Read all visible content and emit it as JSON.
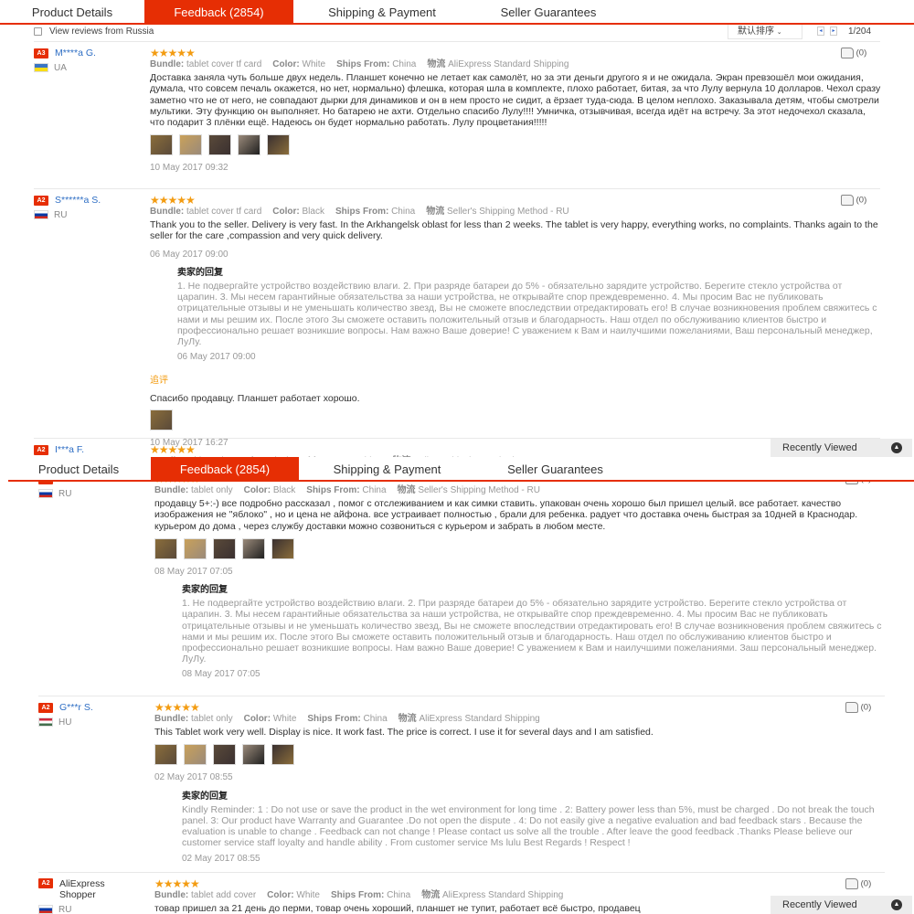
{
  "tabs": [
    "Product Details",
    "Feedback (2854)",
    "Shipping & Payment",
    "Seller Guarantees"
  ],
  "active_tab": 1,
  "accent": "#e62e04",
  "filter": {
    "checkbox_label": "View reviews from Russia",
    "sort_label": "默认排序",
    "sort_icon": "chevron-down-icon",
    "page": "1/204"
  },
  "recently_viewed": "Recently Viewed",
  "labels": {
    "bundle": "Bundle:",
    "color": "Color:",
    "ships_from": "Ships From:",
    "logistics": "物流",
    "seller_reply": "卖家的回复",
    "additional_feedback": "追评"
  },
  "reviews": [
    {
      "badge": "A3",
      "name": "M****a G.",
      "country": "UA",
      "flag_colors": [
        "#3a75c4",
        "#f9dd16"
      ],
      "stars": 5,
      "likes": "(0)",
      "bundle": "tablet cover tf card",
      "color": "White",
      "ships_from": "China",
      "shipping": "AliExpress Standard Shipping",
      "text": "Доставка заняла чуть больше двух недель. Планшет конечно не летает как самолёт, но за эти деньги другого я и не ожидала. Экран превзошёл мои ожидания, думала, что совсем печаль окажется, но нет, нормально) флешка, которая шла в комплекте, плохо работает, битая, за что Лулу вернула 10 долларов. Чехол сразу заметно что не от него, не совпадают дырки для динамиков и он в нем просто не сидит, а ёрзает туда-сюда. В целом неплохо. Заказывала детям, чтобы смотрели мультики. Эту функцию он выполняет. Но батарею не ахти. Отдельно спасибо Лулу!!!! Умничка, отзывчивая, всегда идёт на встречу. За этот недочехол сказала, что подарит 3 плёнки ещё. Надеюсь он будет нормально работать. Лулу процветания!!!!!",
      "images": 5,
      "date": "10 May 2017 09:32"
    },
    {
      "badge": "A2",
      "name": "S******a S.",
      "country": "RU",
      "flag_colors": [
        "#ffffff",
        "#0039a6",
        "#d52b1e"
      ],
      "stars": 5,
      "likes": "(0)",
      "bundle": "tablet cover tf card",
      "color": "Black",
      "ships_from": "China",
      "shipping": "Seller's Shipping Method - RU",
      "text": "Thank you to the seller. Delivery is very fast. In the Arkhangelsk oblast for less than 2 weeks. The tablet is very happy, everything works, no complaints. Thanks again to the seller for the care ,compassion and very quick delivery.",
      "images": 0,
      "date": "06 May 2017 09:00",
      "reply": {
        "text": "1. Не подвергайте устройство воздействию влаги. 2. При разряде батареи до 5% - обязательно зарядите устройство. Берегите стекло устройства от царапин. 3. Мы несем гарантийные обязательства за наши устройства, не открывайте спор преждевременно. 4. Мы просим Вас не публиковать отрицательные отзывы и не уменьшать количество звезд, Вы не сможете впоследствии отредактировать его! В случае возникновения проблем свяжитесь с нами и мы решим их. После этого Зы сможете оставить положительный отзыв и благодарность. Наш отдел по обслуживанию клиентов быстро и профессионально решает возникшие вопросы. Нам важно Ваше доверие! С уважением к Вам и наилучшими пожеланиями, Ваш персональный менеджер, ЛуЛу.",
        "date": "06 May 2017 09:00"
      },
      "additional": {
        "text": "Спасибо продавцу. Планшет работает хорошо.",
        "images": 1,
        "date": "10 May 2017 16:27"
      }
    },
    {
      "badge": "A2",
      "name": "I***a F.",
      "country": "RU",
      "flag_colors": [
        "#ffffff",
        "#0039a6",
        "#d52b1e"
      ],
      "stars": 5,
      "likes": "(0)",
      "bundle": "tablet only",
      "color": "Black",
      "ships_from": "China",
      "shipping": "Seller's Shipping Method - RU",
      "text": "продавцу 5+:-) все подробно рассказал , помог с отслеживанием и как симки ставить. упакован очень хорошо был пришел целый. все работает. качество изображения не \"яблоко\" , но и цена не айфона. все устраивает полностью , брали для ребенка. радует что доставка очень быстрая за 10дней в Краснодар. курьером до дома , через службу доставки можно созвониться с курьером и забрать в любом месте.",
      "images": 5,
      "date": "08 May 2017 07:05",
      "reply": {
        "text": "1. Не подвергайте устройство воздействию влаги. 2. При разряде батареи до 5% - обязательно зарядите устройство. Берегите стекло устройства от царапин. 3. Мы несем гарантийные обязательства за наши устройства, не открывайте спор преждевременно. 4. Мы просим Вас не публиковать отрицательные отзывы и не уменьшать количество звезд, Вы не сможете впоследствии отредактировать его! В случае возникновения проблем свяжитесь с нами и мы решим их. После этого Вы сможете оставить положительный отзыв и благодарность. Наш отдел по обслуживанию клиентов быстро и профессионально решает возникшие вопросы. Нам важно Ваше доверие! С уважением к Вам и наилучшими пожеланиями. Заш персональный менеджер. ЛуЛу.",
        "date": "08 May 2017 07:05"
      }
    },
    {
      "badge": "A2",
      "name": "G***r S.",
      "country": "HU",
      "flag_colors": [
        "#cd2a3e",
        "#ffffff",
        "#436f4d"
      ],
      "stars": 5,
      "likes": "(0)",
      "bundle": "tablet only",
      "color": "White",
      "ships_from": "China",
      "shipping": "AliExpress Standard Shipping",
      "text": "This Tablet work very well. Display is nice. It work fast. The price is correct. I use it for several days and I am satisfied.",
      "images": 5,
      "date": "02 May 2017 08:55",
      "reply": {
        "text": "Kindly Reminder: 1 : Do not use or save the product in the wet environment for long time . 2: Battery power less than 5%, must be charged . Do not break the touch panel. 3: Our product have Warranty and Guarantee .Do not open the dispute . 4: Do not easily give a negative evaluation and bad feedback stars . Because the evaluation is unable to change . Feedback can not change ! Please contact us solve all the trouble . After leave the good feedback .Thanks Please believe our customer service staff loyalty and handle ability . From customer service Ms lulu Best Regards ! Respect !",
        "date": "02 May 2017 08:55"
      }
    },
    {
      "badge": "A2",
      "name": "AliExpress Shopper",
      "country": "RU",
      "flag_colors": [
        "#ffffff",
        "#0039a6",
        "#d52b1e"
      ],
      "stars": 5,
      "likes": "(0)",
      "bundle": "tablet add cover",
      "color": "White",
      "ships_from": "China",
      "shipping": "AliExpress Standard Shipping",
      "text": "товар пришел за 21 день до перми, товар очень хороший, планшет не тупит, работает всё быстро, продавец",
      "images": 0,
      "date": ""
    }
  ]
}
